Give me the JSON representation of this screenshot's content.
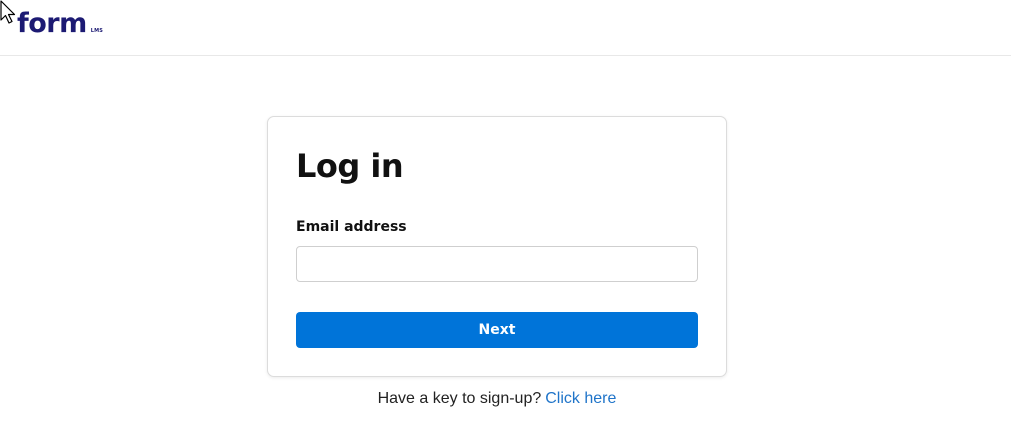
{
  "header": {
    "logo_text": "form",
    "logo_subtext": "LMS"
  },
  "login": {
    "title": "Log in",
    "email_label": "Email address",
    "email_value": "",
    "email_placeholder": "",
    "next_label": "Next"
  },
  "footer": {
    "signup_prompt": "Have a key to sign-up?",
    "signup_link": "Click here"
  },
  "colors": {
    "brand": "#1c1a73",
    "primary_button": "#0074d9",
    "link": "#1f74c9"
  },
  "icons": {
    "cursor": "mouse-pointer-icon"
  }
}
